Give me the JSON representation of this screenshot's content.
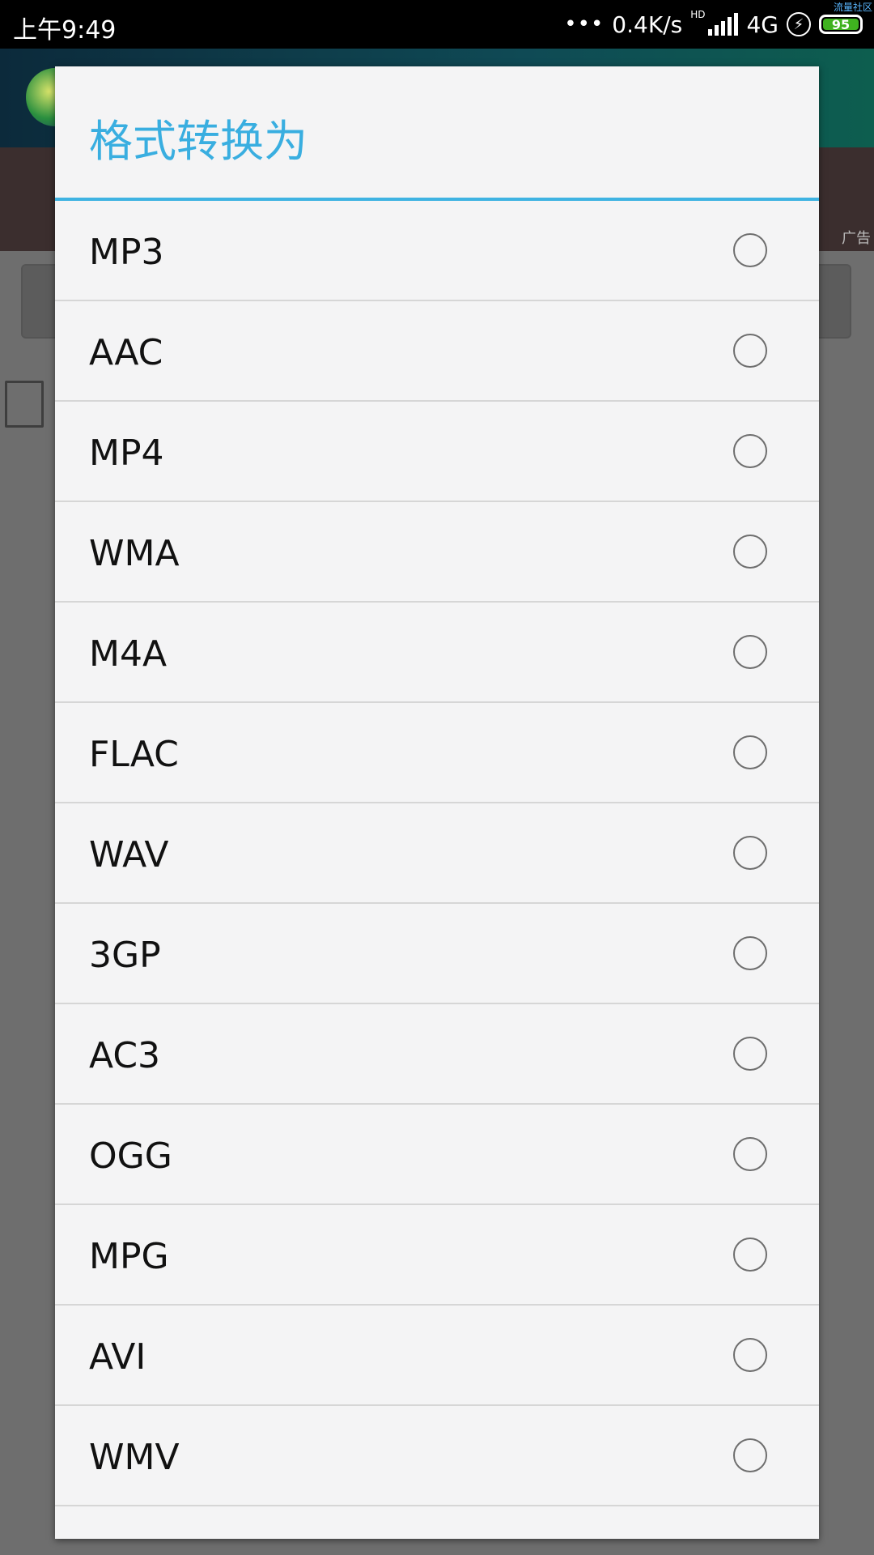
{
  "status_bar": {
    "time": "上午9:49",
    "network_speed": "0.4K/s",
    "hd_label": "HD",
    "network_type": "4G",
    "battery": "95",
    "corner_text": "流量社区"
  },
  "background_app": {
    "ad_label": "广告"
  },
  "dialog": {
    "title": "格式转换为",
    "options": [
      {
        "label": "MP3",
        "selected": false
      },
      {
        "label": "AAC",
        "selected": false
      },
      {
        "label": "MP4",
        "selected": false
      },
      {
        "label": "WMA",
        "selected": false
      },
      {
        "label": "M4A",
        "selected": false
      },
      {
        "label": "FLAC",
        "selected": false
      },
      {
        "label": "WAV",
        "selected": false
      },
      {
        "label": "3GP",
        "selected": false
      },
      {
        "label": "AC3",
        "selected": false
      },
      {
        "label": "OGG",
        "selected": false
      },
      {
        "label": "MPG",
        "selected": false
      },
      {
        "label": "AVI",
        "selected": false
      },
      {
        "label": "WMV",
        "selected": false
      }
    ]
  },
  "colors": {
    "accent": "#39aee0",
    "dialog_bg": "#f4f4f5",
    "divider": "#d6d6d6",
    "battery_green": "#3fb21f"
  }
}
